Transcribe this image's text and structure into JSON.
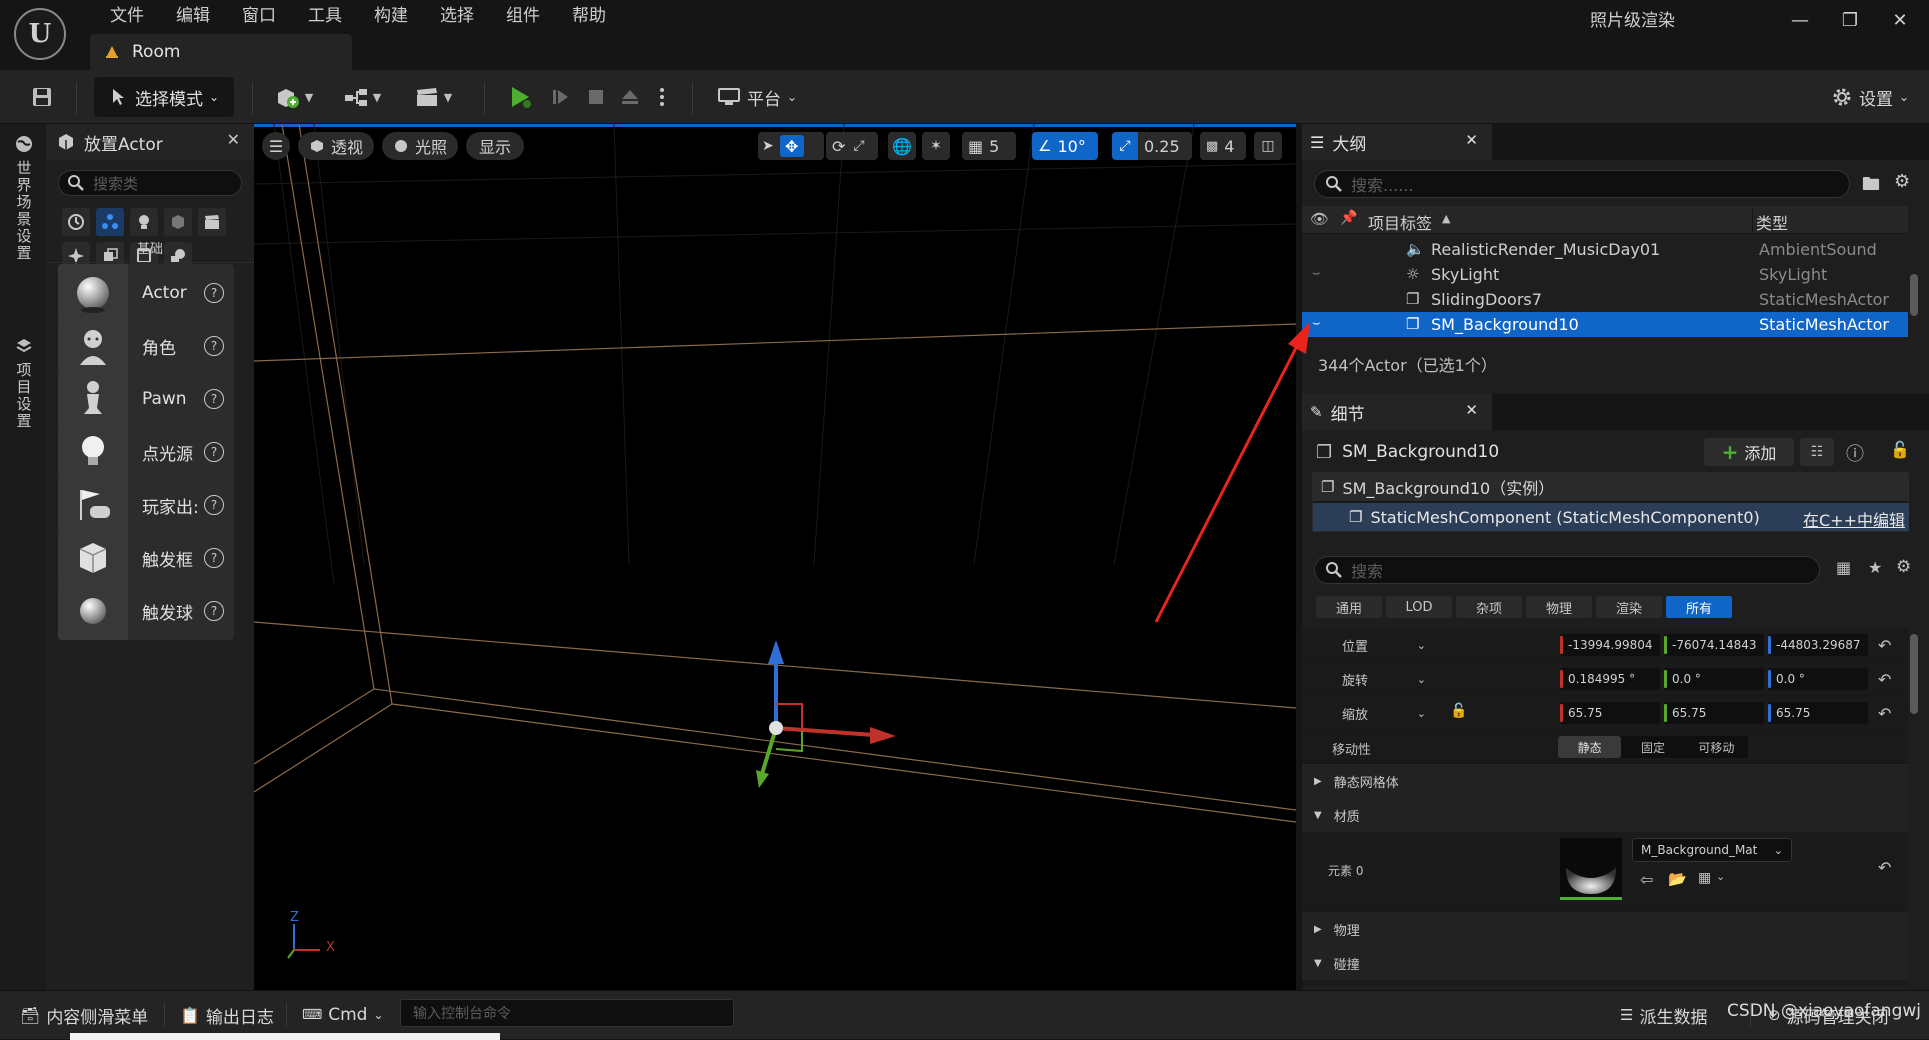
{
  "app": {
    "logo_text": "U",
    "project_tab": "Room",
    "render_label": "照片级渲染"
  },
  "menu": [
    "文件",
    "编辑",
    "窗口",
    "工具",
    "构建",
    "选择",
    "组件",
    "帮助"
  ],
  "toolbar": {
    "mode": "选择模式",
    "platform": "平台",
    "settings": "设置"
  },
  "leftstrip": {
    "world_settings": "世界场景设置",
    "project_settings": "项目设置"
  },
  "place_actors": {
    "title": "放置Actor",
    "search_placeholder": "搜索类",
    "category_label": "基础",
    "items": [
      "Actor",
      "角色",
      "Pawn",
      "点光源",
      "玩家出:",
      "触发框",
      "触发球"
    ]
  },
  "viewport": {
    "perspective": "透视",
    "lighting": "光照",
    "show": "显示",
    "grid_size": "5",
    "rotation_snap": "10°",
    "scale_snap": "0.25",
    "camera_speed": "4",
    "axis_z": "Z",
    "axis_x": "X"
  },
  "outliner": {
    "title": "大纲",
    "search_placeholder": "搜索......",
    "col_label": "项目标签",
    "col_type": "类型",
    "rows": [
      {
        "name": "RealisticRender_MusicDay01",
        "type": "AmbientSound",
        "icon": "speaker-icon"
      },
      {
        "name": "SkyLight",
        "type": "SkyLight",
        "icon": "skylight-icon"
      },
      {
        "name": "SlidingDoors7",
        "type": "StaticMeshActor",
        "icon": "cube-icon"
      },
      {
        "name": "SM_Background10",
        "type": "StaticMeshActor",
        "icon": "cube-icon",
        "selected": true
      }
    ],
    "status": "344个Actor（已选1个）"
  },
  "details": {
    "title": "细节",
    "actor_name": "SM_Background10",
    "add_button": "添加",
    "instance_label": "SM_Background10（实例）",
    "component": "StaticMeshComponent (StaticMeshComponent0)",
    "edit_cpp": "在C++中编辑",
    "search_placeholder": "搜索",
    "tabs": [
      "通用",
      "LOD",
      "杂项",
      "物理",
      "渲染",
      "所有"
    ],
    "active_tab": "所有",
    "location": {
      "label": "位置",
      "x": "-13994.99804",
      "y": "-76074.14843",
      "z": "-44803.29687"
    },
    "rotation": {
      "label": "旋转",
      "x": "0.184995 °",
      "y": "0.0 °",
      "z": "0.0 °"
    },
    "scale": {
      "label": "缩放",
      "x": "65.75",
      "y": "65.75",
      "z": "65.75"
    },
    "mobility": {
      "label": "移动性",
      "options": [
        "静态",
        "固定",
        "可移动"
      ],
      "active": "静态"
    },
    "sections": {
      "static_mesh": "静态网格体",
      "materials": "材质",
      "element0": "元素 0",
      "material_name": "M_Background_Mat",
      "physics": "物理",
      "collision": "碰撞"
    }
  },
  "bottombar": {
    "content_drawer": "内容侧滑菜单",
    "output_log": "输出日志",
    "cmd": "Cmd",
    "console_placeholder": "输入控制台命令",
    "derived_data": "派生数据",
    "source_control": "源码管理关闭",
    "watermark": "CSDN @xiaoyaofangwj"
  },
  "colors": {
    "accent": "#0f65c8",
    "play_green": "#4caf2f",
    "annotation_red": "#e8241c"
  }
}
